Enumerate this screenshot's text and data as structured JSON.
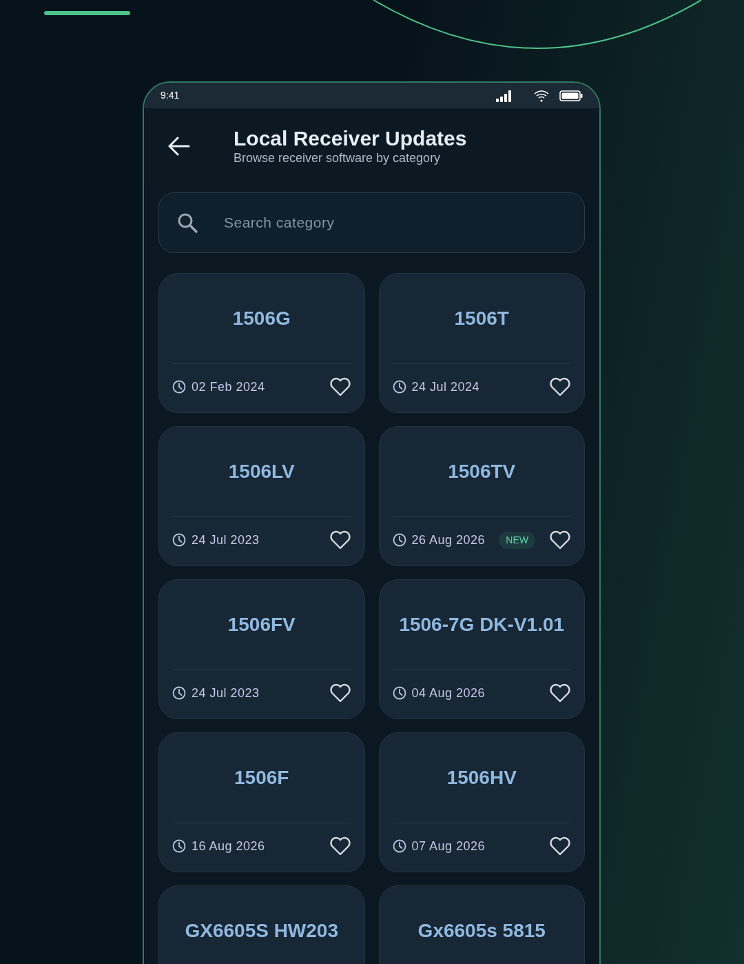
{
  "status_bar": {
    "time": "9:41"
  },
  "header": {
    "title": "Local Receiver Updates",
    "subtitle": "Browse receiver software by category"
  },
  "search": {
    "placeholder": "Search category"
  },
  "categories": [
    {
      "name": "1506G",
      "date": "02 Feb 2024",
      "new": false,
      "favorite": false
    },
    {
      "name": "1506T",
      "date": "24 Jul 2024",
      "new": false,
      "favorite": false
    },
    {
      "name": "1506LV",
      "date": "24 Jul 2023",
      "new": false,
      "favorite": false
    },
    {
      "name": "1506TV",
      "date": "26 Aug 2026",
      "new": true,
      "badge": "NEW",
      "favorite": false
    },
    {
      "name": "1506FV",
      "date": "24 Jul 2023",
      "new": false,
      "favorite": false
    },
    {
      "name": "1506-7G DK-V1.01",
      "date": "04 Aug 2026",
      "new": false,
      "favorite": false
    },
    {
      "name": "1506F",
      "date": "16 Aug 2026",
      "new": false,
      "favorite": false
    },
    {
      "name": "1506HV",
      "date": "07 Aug 2026",
      "new": false,
      "favorite": false
    },
    {
      "name": "GX6605S HW203"
    },
    {
      "name": "Gx6605s 5815"
    }
  ]
}
